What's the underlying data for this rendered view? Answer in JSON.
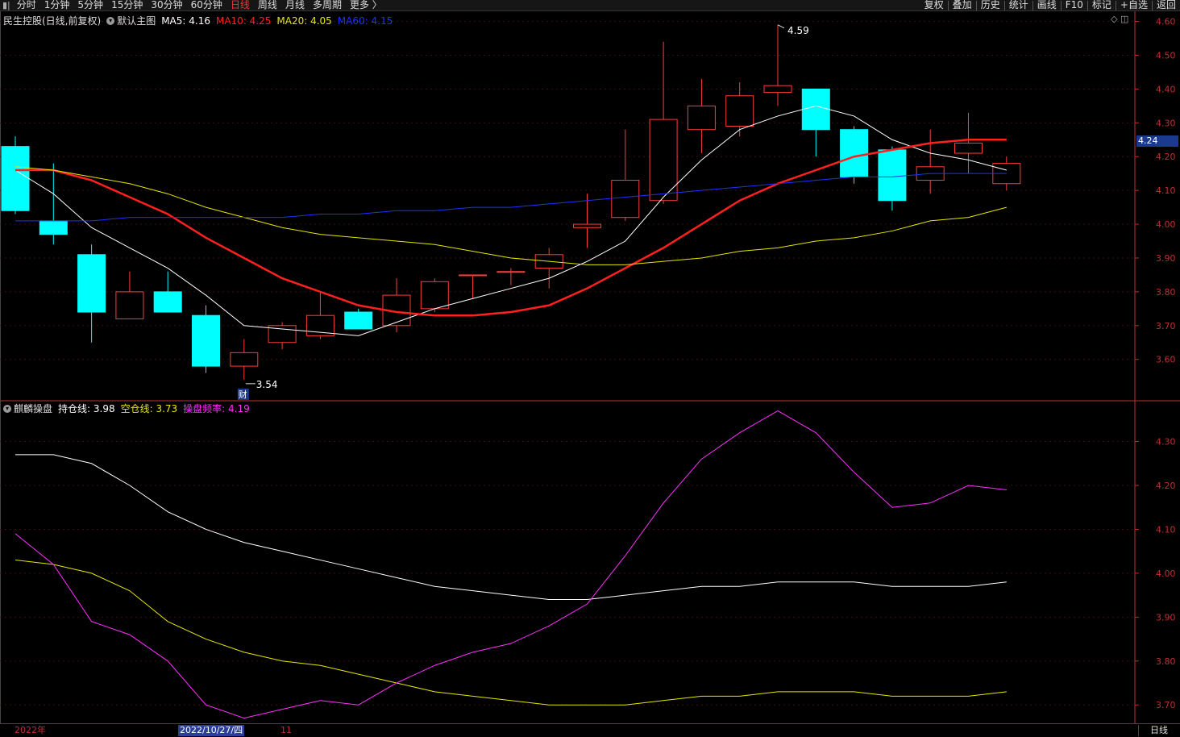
{
  "toolbar": {
    "left_tabs": [
      "分时",
      "1分钟",
      "5分钟",
      "15分钟",
      "30分钟",
      "60分钟",
      "日线",
      "周线",
      "月线",
      "多周期",
      "更多 〉"
    ],
    "active_tab": "日线",
    "right_buttons": [
      "复权",
      "叠加",
      "历史",
      "统计",
      "画线",
      "F10",
      "标记",
      "+自选",
      "返回"
    ]
  },
  "main_header": {
    "stock": "民生控股(日线,前复权)",
    "template": "默认主图",
    "ma5": "MA5: 4.16",
    "ma10": "MA10: 4.25",
    "ma20": "MA20: 4.05",
    "ma60": "MA60: 4.15"
  },
  "sub_header": {
    "indicator": "麒麟操盘",
    "line1": "持仓线: 3.98",
    "line2": "空仓线: 3.73",
    "line3": "操盘频率: 4.19"
  },
  "colors": {
    "up": "#ff3b3b",
    "down": "#00ffff",
    "ma5": "#ffffff",
    "ma10": "#ff2020",
    "ma20": "#e6e600",
    "ma60": "#2030ff",
    "hold": "#ffffff",
    "empty": "#e6e600",
    "freq": "#ff30ff",
    "axis": "#c03030"
  },
  "current_price_tag": "4.24",
  "annotations": {
    "high": "4.59",
    "low": "3.54",
    "event": "财"
  },
  "bottom": {
    "year_label": "2022年",
    "cursor_date": "2022/10/27/四",
    "month_label": "11",
    "period_button": "日线"
  },
  "chart_data": [
    {
      "type": "candlestick",
      "title": "民生控股(日线,前复权)",
      "y_ticks": [
        3.6,
        3.7,
        3.8,
        3.9,
        4.0,
        4.1,
        4.2,
        4.3,
        4.4,
        4.5,
        4.6
      ],
      "ylim": [
        3.48,
        4.63
      ],
      "candles": [
        {
          "o": 4.23,
          "h": 4.26,
          "l": 4.03,
          "c": 4.04
        },
        {
          "o": 4.01,
          "h": 4.18,
          "l": 3.94,
          "c": 3.97
        },
        {
          "o": 3.91,
          "h": 3.94,
          "l": 3.65,
          "c": 3.74
        },
        {
          "o": 3.72,
          "h": 3.86,
          "l": 3.72,
          "c": 3.8
        },
        {
          "o": 3.8,
          "h": 3.86,
          "l": 3.74,
          "c": 3.74
        },
        {
          "o": 3.73,
          "h": 3.76,
          "l": 3.56,
          "c": 3.58
        },
        {
          "o": 3.58,
          "h": 3.66,
          "l": 3.54,
          "c": 3.62
        },
        {
          "o": 3.65,
          "h": 3.71,
          "l": 3.63,
          "c": 3.7
        },
        {
          "o": 3.67,
          "h": 3.8,
          "l": 3.66,
          "c": 3.73
        },
        {
          "o": 3.74,
          "h": 3.75,
          "l": 3.69,
          "c": 3.69
        },
        {
          "o": 3.7,
          "h": 3.84,
          "l": 3.68,
          "c": 3.79
        },
        {
          "o": 3.75,
          "h": 3.84,
          "l": 3.74,
          "c": 3.83
        },
        {
          "o": 3.85,
          "h": 3.85,
          "l": 3.78,
          "c": 3.85
        },
        {
          "o": 3.86,
          "h": 3.87,
          "l": 3.82,
          "c": 3.86
        },
        {
          "o": 3.87,
          "h": 3.93,
          "l": 3.81,
          "c": 3.91
        },
        {
          "o": 3.99,
          "h": 4.09,
          "l": 3.93,
          "c": 4.0
        },
        {
          "o": 4.02,
          "h": 4.28,
          "l": 4.01,
          "c": 4.13
        },
        {
          "o": 4.07,
          "h": 4.54,
          "l": 4.06,
          "c": 4.31
        },
        {
          "o": 4.28,
          "h": 4.43,
          "l": 4.21,
          "c": 4.35
        },
        {
          "o": 4.29,
          "h": 4.42,
          "l": 4.26,
          "c": 4.38
        },
        {
          "o": 4.39,
          "h": 4.59,
          "l": 4.35,
          "c": 4.41
        },
        {
          "o": 4.4,
          "h": 4.4,
          "l": 4.2,
          "c": 4.28
        },
        {
          "o": 4.28,
          "h": 4.29,
          "l": 4.12,
          "c": 4.14
        },
        {
          "o": 4.22,
          "h": 4.23,
          "l": 4.04,
          "c": 4.07
        },
        {
          "o": 4.13,
          "h": 4.28,
          "l": 4.09,
          "c": 4.17
        },
        {
          "o": 4.21,
          "h": 4.33,
          "l": 4.15,
          "c": 4.24
        },
        {
          "o": 4.12,
          "h": 4.2,
          "l": 4.1,
          "c": 4.18
        }
      ],
      "series": [
        {
          "name": "MA5",
          "values": [
            4.16,
            4.09,
            3.99,
            3.93,
            3.87,
            3.79,
            3.7,
            3.69,
            3.68,
            3.67,
            3.71,
            3.75,
            3.78,
            3.81,
            3.84,
            3.89,
            3.95,
            4.08,
            4.19,
            4.28,
            4.32,
            4.35,
            4.32,
            4.25,
            4.21,
            4.19,
            4.16
          ]
        },
        {
          "name": "MA10",
          "values": [
            4.16,
            4.16,
            4.13,
            4.08,
            4.03,
            3.96,
            3.9,
            3.84,
            3.8,
            3.76,
            3.74,
            3.73,
            3.73,
            3.74,
            3.76,
            3.81,
            3.87,
            3.93,
            4.0,
            4.07,
            4.12,
            4.16,
            4.2,
            4.22,
            4.24,
            4.25,
            4.25
          ]
        },
        {
          "name": "MA20",
          "values": [
            4.17,
            4.16,
            4.14,
            4.12,
            4.09,
            4.05,
            4.02,
            3.99,
            3.97,
            3.96,
            3.95,
            3.94,
            3.92,
            3.9,
            3.89,
            3.88,
            3.88,
            3.89,
            3.9,
            3.92,
            3.93,
            3.95,
            3.96,
            3.98,
            4.01,
            4.02,
            4.05
          ]
        },
        {
          "name": "MA60",
          "values": [
            4.01,
            4.01,
            4.01,
            4.02,
            4.02,
            4.02,
            4.02,
            4.02,
            4.03,
            4.03,
            4.04,
            4.04,
            4.05,
            4.05,
            4.06,
            4.07,
            4.08,
            4.09,
            4.1,
            4.11,
            4.12,
            4.13,
            4.14,
            4.14,
            4.15,
            4.15,
            4.15
          ]
        }
      ]
    },
    {
      "type": "line",
      "title": "麒麟操盘",
      "y_ticks": [
        3.7,
        3.8,
        3.9,
        4.0,
        4.1,
        4.2,
        4.3
      ],
      "ylim": [
        3.66,
        4.38
      ],
      "series": [
        {
          "name": "持仓线",
          "values": [
            4.27,
            4.27,
            4.25,
            4.2,
            4.14,
            4.1,
            4.07,
            4.05,
            4.03,
            4.01,
            3.99,
            3.97,
            3.96,
            3.95,
            3.94,
            3.94,
            3.95,
            3.96,
            3.97,
            3.97,
            3.98,
            3.98,
            3.98,
            3.97,
            3.97,
            3.97,
            3.98
          ]
        },
        {
          "name": "空仓线",
          "values": [
            4.03,
            4.02,
            4.0,
            3.96,
            3.89,
            3.85,
            3.82,
            3.8,
            3.79,
            3.77,
            3.75,
            3.73,
            3.72,
            3.71,
            3.7,
            3.7,
            3.7,
            3.71,
            3.72,
            3.72,
            3.73,
            3.73,
            3.73,
            3.72,
            3.72,
            3.72,
            3.73
          ]
        },
        {
          "name": "操盘频率",
          "values": [
            4.09,
            4.02,
            3.89,
            3.86,
            3.8,
            3.7,
            3.67,
            3.69,
            3.71,
            3.7,
            3.75,
            3.79,
            3.82,
            3.84,
            3.88,
            3.93,
            4.04,
            4.16,
            4.26,
            4.32,
            4.37,
            4.32,
            4.23,
            4.15,
            4.16,
            4.2,
            4.19
          ]
        }
      ]
    }
  ]
}
